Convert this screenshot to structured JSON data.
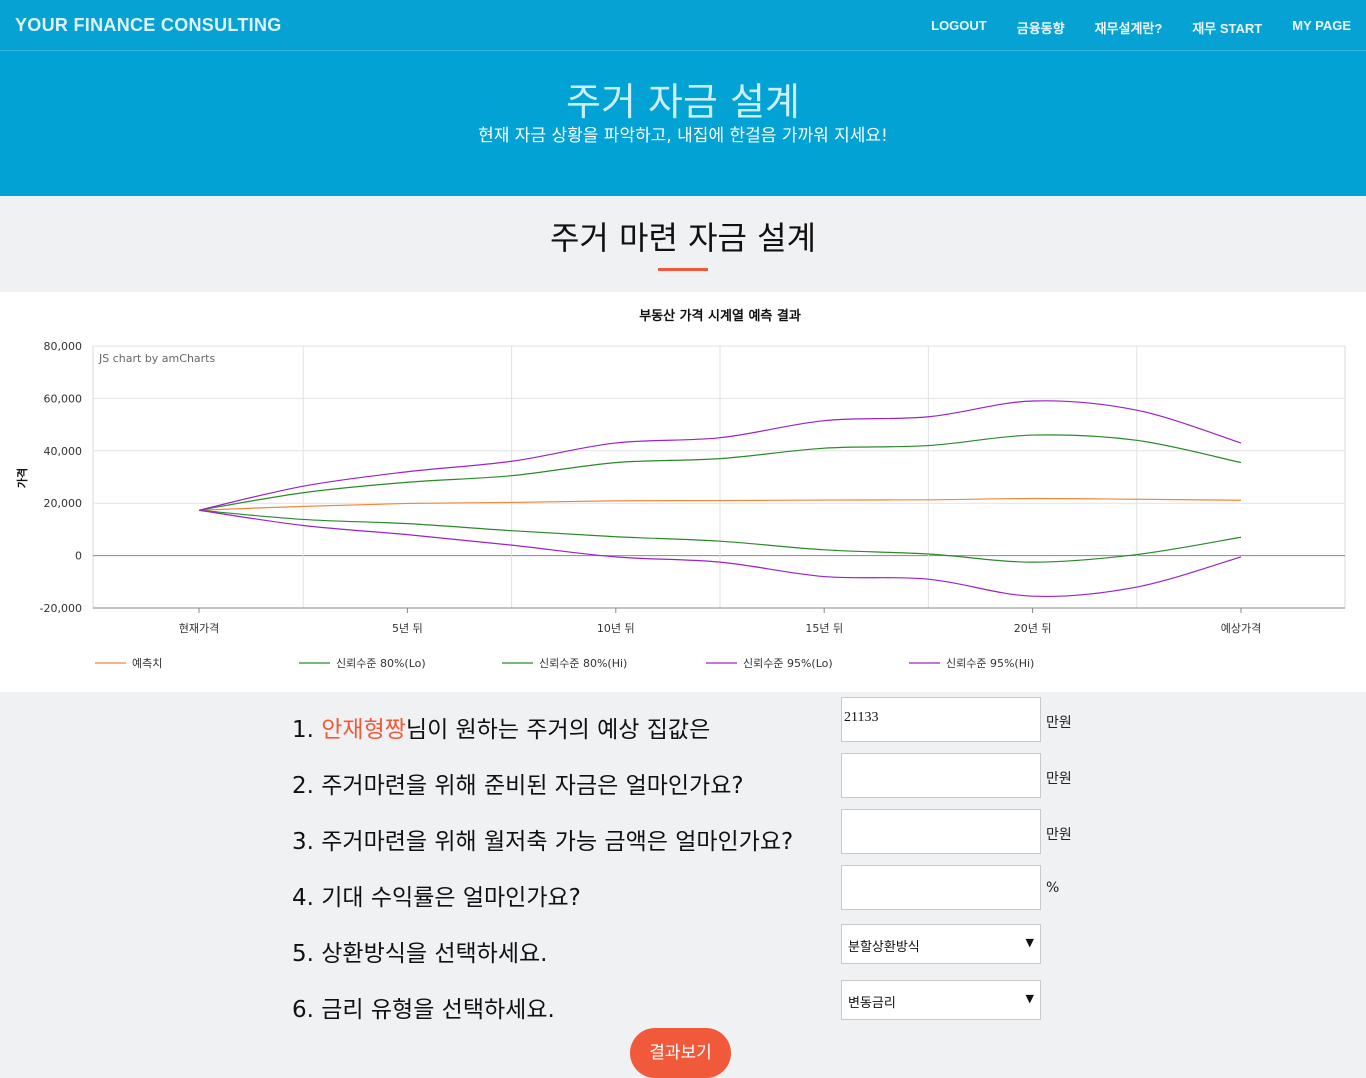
{
  "nav": {
    "brand": "YOUR FINANCE CONSULTING",
    "links": [
      "LOGOUT",
      "금융동향",
      "재무설계란?",
      "재무 START",
      "MY PAGE"
    ]
  },
  "hero": {
    "title": "주거 자금 설계",
    "subtitle": "현재 자금 상황을 파악하고, 내집에 한걸음 가까워 지세요!"
  },
  "section": {
    "title": "주거 마련 자금 설계"
  },
  "chart_data": {
    "type": "line",
    "title": "부동산 가격 시계열 예측 결과",
    "credit": "JS chart by amCharts",
    "ylabel": "가격",
    "xlabel": "",
    "categories": [
      "현재가격",
      "",
      "5년 뒤",
      "",
      "10년 뒤",
      "",
      "15년 뒤",
      "",
      "20년 뒤",
      "",
      "예상가격"
    ],
    "ylim": [
      -20000,
      80000
    ],
    "yticks": [
      "80,000",
      "60,000",
      "40,000",
      "20,000",
      "0",
      "-20,000"
    ],
    "grid": true,
    "legend_position": "bottom",
    "series": [
      {
        "name": "예측치",
        "color": "#f0883a",
        "values": [
          17300,
          18800,
          19900,
          20300,
          20900,
          21000,
          21200,
          21300,
          21800,
          21500,
          21133
        ]
      },
      {
        "name": "신뢰수준 80%(Lo)",
        "color": "#2a8a2a",
        "values": [
          17300,
          13800,
          12200,
          9500,
          7200,
          5500,
          2200,
          600,
          -2500,
          400,
          7000
        ]
      },
      {
        "name": "신뢰수준 80%(Hi)",
        "color": "#2a8a2a",
        "values": [
          17300,
          24000,
          28000,
          30500,
          35500,
          37000,
          41000,
          42000,
          46000,
          44000,
          35500
        ]
      },
      {
        "name": "신뢰수준 95%(Lo)",
        "color": "#9a22c8",
        "values": [
          17300,
          11500,
          8000,
          4000,
          -500,
          -2500,
          -8000,
          -9000,
          -15500,
          -12000,
          -500
        ]
      },
      {
        "name": "신뢰수준 95%(Hi)",
        "color": "#9a22c8",
        "values": [
          17300,
          26500,
          32000,
          36000,
          43000,
          45000,
          51500,
          53000,
          59000,
          55500,
          43000
        ]
      }
    ]
  },
  "form": {
    "q1": {
      "num": "1. ",
      "name": "안재형짱",
      "rest": "님이 원하는 주거의 예상 집값은",
      "value": "21133",
      "unit": "만원"
    },
    "q2": {
      "text": "2. 주거마련을 위해 준비된 자금은 얼마인가요?",
      "value": "",
      "unit": "만원"
    },
    "q3": {
      "text": "3. 주거마련을 위해 월저축 가능 금액은 얼마인가요?",
      "value": "",
      "unit": "만원"
    },
    "q4": {
      "text": "4. 기대 수익률은 얼마인가요?",
      "value": "",
      "unit": "%"
    },
    "q5": {
      "text": "5. 상환방식을 선택하세요.",
      "selected": "분할상환방식"
    },
    "q6": {
      "text": "6. 금리 유형을 선택하세요.",
      "selected": "변동금리"
    },
    "submit": "결과보기"
  }
}
